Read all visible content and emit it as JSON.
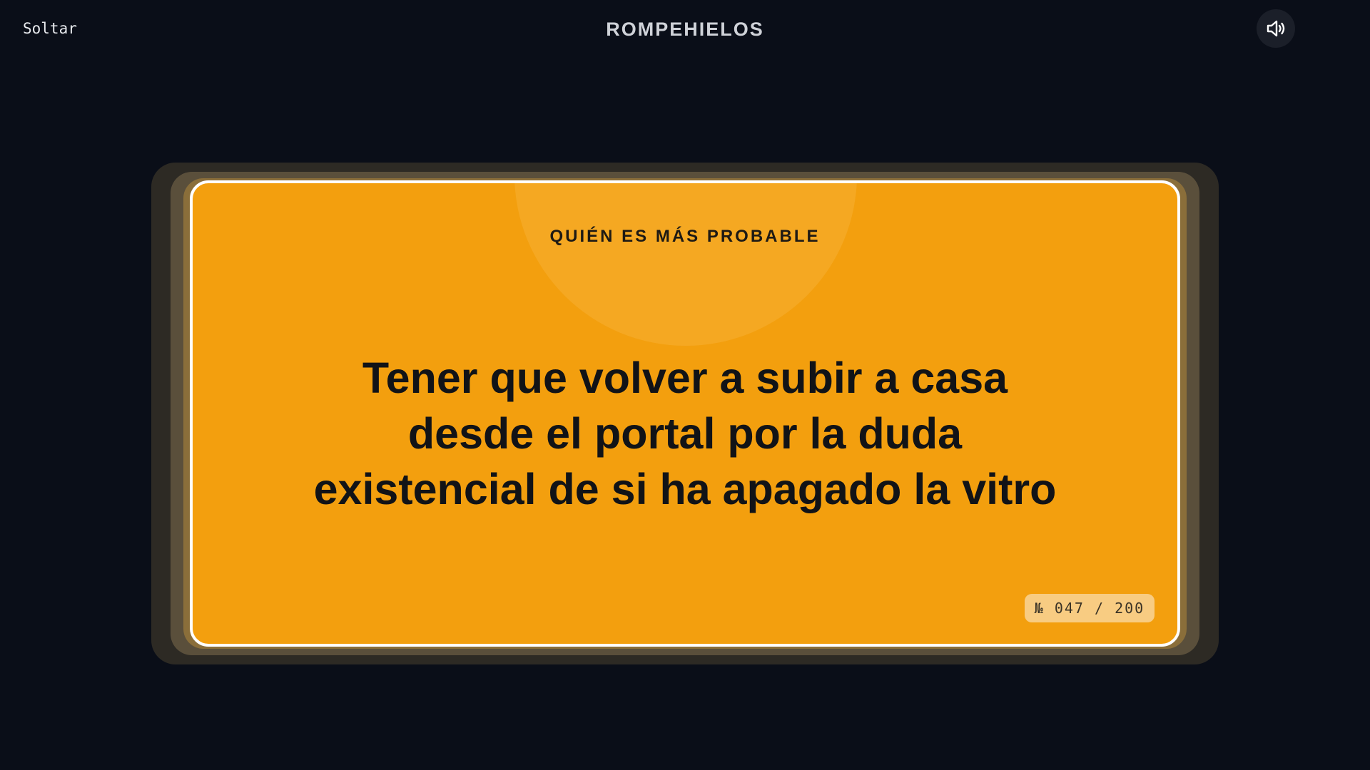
{
  "header": {
    "leave_label": "Soltar",
    "title": "ROMPEHIELOS",
    "sound_icon": "speaker-volume-icon"
  },
  "card": {
    "category": "QUIÉN ES MÁS PROBABLE",
    "prompt": "Tener que volver a subir a casa desde el portal por la duda existencial de si ha apagado la vitro",
    "counter": "№ 047 / 200",
    "current": 47,
    "total": 200
  },
  "colors": {
    "background": "#0a0e18",
    "card": "#f39f0e",
    "card_border": "#ffffff",
    "text_dark": "#111317",
    "counter_bg": "#f8cc82"
  }
}
